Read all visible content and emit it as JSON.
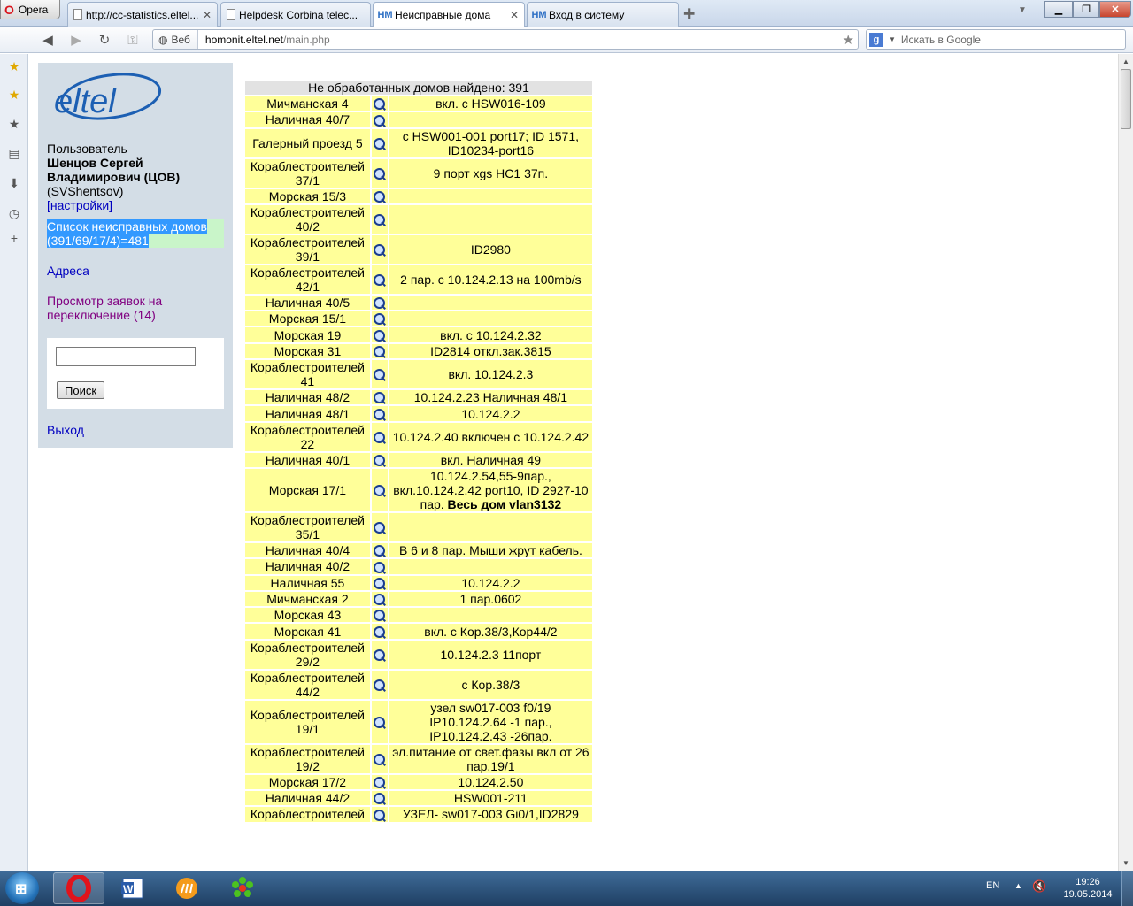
{
  "browser": {
    "menu_label": "Opera",
    "tabs": [
      {
        "title": "http://cc-statistics.eltel..."
      },
      {
        "title": "Helpdesk Corbina telec..."
      },
      {
        "title": "Неисправные дома"
      },
      {
        "title": "Вход в систему"
      }
    ],
    "address": {
      "prefix": "Веб",
      "url_host": "homonit.eltel.net",
      "url_path": "/main.php"
    },
    "search_placeholder": "Искать в Google"
  },
  "sidebar": {
    "logo_text": "eltel",
    "user_label": "Пользователь",
    "user_name": "Шенцов Сергей Владимирович (ЦОВ)",
    "user_login": "(SVShentsov)",
    "settings_link": "[настройки]",
    "broken_houses_link": "Список неисправных домов (391/69/17/4)=481",
    "addresses_link": "Адреса",
    "requests_link": "Просмотр заявок на переключение (14)",
    "search_button": "Поиск",
    "search_value": "",
    "exit_link": "Выход"
  },
  "table": {
    "header": "Не обработанных домов найдено: 391",
    "rows": [
      {
        "name": "Мичманская 4",
        "note": "вкл. с HSW016-109"
      },
      {
        "name": "Наличная 40/7",
        "note": ""
      },
      {
        "name": "Галерный проезд 5",
        "note": "с HSW001-001 port17; ID 1571, ID10234-port16"
      },
      {
        "name": "Кораблестроителей 37/1",
        "note": "9 порт xgs HC1 37п."
      },
      {
        "name": "Морская 15/3",
        "note": ""
      },
      {
        "name": "Кораблестроителей 40/2",
        "note": ""
      },
      {
        "name": "Кораблестроителей 39/1",
        "note": "ID2980"
      },
      {
        "name": "Кораблестроителей 42/1",
        "note": "2 пар. с 10.124.2.13 на 100mb/s"
      },
      {
        "name": "Наличная 40/5",
        "note": ""
      },
      {
        "name": "Морская 15/1",
        "note": ""
      },
      {
        "name": "Морская 19",
        "note": "вкл. с 10.124.2.32"
      },
      {
        "name": "Морская 31",
        "note": "ID2814 откл.зак.3815"
      },
      {
        "name": "Кораблестроителей 41",
        "note": "вкл. 10.124.2.3"
      },
      {
        "name": "Наличная 48/2",
        "note": "10.124.2.23 Наличная 48/1"
      },
      {
        "name": "Наличная 48/1",
        "note": "10.124.2.2"
      },
      {
        "name": "Кораблестроителей 22",
        "note": "10.124.2.40 включен с 10.124.2.42"
      },
      {
        "name": "Наличная 40/1",
        "note": "вкл. Наличная 49"
      },
      {
        "name": "Морская 17/1",
        "note": "10.124.2.54,55-9пар., вкл.10.124.2.42 port10, ID 2927-10 пар.",
        "note_bold": "Весь дом vlan3132"
      },
      {
        "name": "Кораблестроителей 35/1",
        "note": ""
      },
      {
        "name": "Наличная 40/4",
        "note": "В 6 и 8 пар. Мыши жрут кабель."
      },
      {
        "name": "Наличная 40/2",
        "note": ""
      },
      {
        "name": "Наличная 55",
        "note": "10.124.2.2"
      },
      {
        "name": "Мичманская 2",
        "note": "1 пар.0602"
      },
      {
        "name": "Морская 43",
        "note": ""
      },
      {
        "name": "Морская 41",
        "note": "вкл. с Кор.38/3,Кор44/2"
      },
      {
        "name": "Кораблестроителей 29/2",
        "note": "10.124.2.3 11порт"
      },
      {
        "name": "Кораблестроителей 44/2",
        "note": "с Кор.38/3"
      },
      {
        "name": "Кораблестроителей 19/1",
        "note": "узел sw017-003 f0/19 IP10.124.2.64 -1 пар., IP10.124.2.43 -26пар."
      },
      {
        "name": "Кораблестроителей 19/2",
        "note": "эл.питание от свет.фазы вкл от 26 пар.19/1"
      },
      {
        "name": "Морская 17/2",
        "note": "10.124.2.50"
      },
      {
        "name": "Наличная 44/2",
        "note": "HSW001-211"
      },
      {
        "name": "Кораблестроителей",
        "note": "УЗЕЛ- sw017-003 Gi0/1,ID2829"
      }
    ]
  },
  "taskbar": {
    "lang": "EN",
    "time": "19:26",
    "date": "19.05.2014"
  }
}
